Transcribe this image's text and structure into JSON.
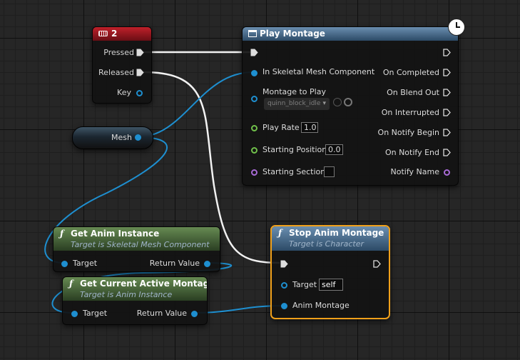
{
  "key_node": {
    "title": "2",
    "pins": [
      "Pressed",
      "Released",
      "Key"
    ]
  },
  "play_montage": {
    "title": "Play Montage",
    "inputs": {
      "mesh_component": "In Skeletal Mesh Component",
      "montage": "Montage to Play",
      "montage_value": "quinn_block_idle",
      "play_rate": "Play Rate",
      "play_rate_value": "1.0",
      "start_position": "Starting Position",
      "start_position_value": "0.0",
      "start_section": "Starting Section"
    },
    "outputs": [
      "On Completed",
      "On Blend Out",
      "On Interrupted",
      "On Notify Begin",
      "On Notify End",
      "Notify Name"
    ]
  },
  "mesh_node": {
    "label": "Mesh"
  },
  "get_anim_instance": {
    "title": "Get Anim Instance",
    "subtitle": "Target is Skeletal Mesh Component",
    "target": "Target",
    "return": "Return Value"
  },
  "get_current_montage": {
    "title": "Get Current Active Montage",
    "subtitle": "Target is Anim Instance",
    "target": "Target",
    "return": "Return Value"
  },
  "stop_montage": {
    "title": "Stop Anim Montage",
    "subtitle": "Target is Character",
    "target": "Target",
    "target_value": "self",
    "anim_montage": "Anim Montage"
  },
  "colors": {
    "exec": "#ffffff",
    "object": "#1e8fd0",
    "float": "#71c14b",
    "name": "#a86bd6",
    "selection": "#f0a01a"
  },
  "icons": {
    "function": "f",
    "latent": "clock-icon",
    "keyboard": "keyboard-icon"
  }
}
